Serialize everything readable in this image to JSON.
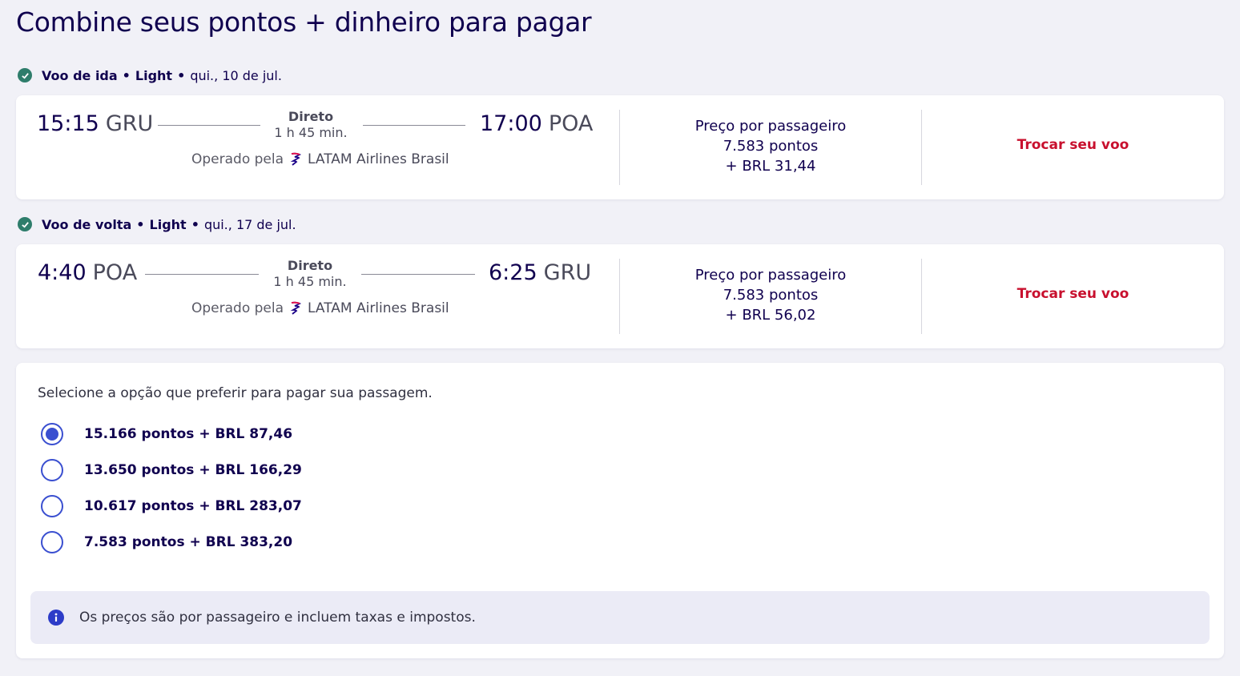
{
  "page": {
    "title": "Combine seus pontos + dinheiro para pagar"
  },
  "outbound": {
    "header": {
      "leg": "Voo de ida",
      "fare": "Light",
      "date": "qui., 10 de jul."
    },
    "dep_time": "15:15",
    "dep_code": "GRU",
    "arr_time": "17:00",
    "arr_code": "POA",
    "stops": "Direto",
    "duration": "1 h 45 min.",
    "operated_prefix": "Operado pela",
    "airline": "LATAM Airlines Brasil",
    "price_label": "Preço por passageiro",
    "price_points": "7.583 pontos",
    "price_cash": "+ BRL 31,44",
    "change_label": "Trocar seu voo"
  },
  "return": {
    "header": {
      "leg": "Voo de volta",
      "fare": "Light",
      "date": "qui., 17 de jul."
    },
    "dep_time": "4:40",
    "dep_code": "POA",
    "arr_time": "6:25",
    "arr_code": "GRU",
    "stops": "Direto",
    "duration": "1 h 45 min.",
    "operated_prefix": "Operado pela",
    "airline": "LATAM Airlines Brasil",
    "price_label": "Preço por passageiro",
    "price_points": "7.583 pontos",
    "price_cash": "+ BRL 56,02",
    "change_label": "Trocar seu voo"
  },
  "payment": {
    "intro": "Selecione a opção que preferir para pagar sua passagem.",
    "options": [
      {
        "label": "15.166 pontos + BRL 87,46",
        "selected": true
      },
      {
        "label": "13.650 pontos + BRL 166,29",
        "selected": false
      },
      {
        "label": "10.617 pontos + BRL 283,07",
        "selected": false
      },
      {
        "label": "7.583 pontos + BRL 383,20",
        "selected": false
      }
    ],
    "info": "Os preços são por passageiro e incluem taxas e impostos."
  },
  "colors": {
    "brand_navy": "#10004f",
    "accent_red": "#c8102e",
    "radio_blue": "#3a4fd0",
    "check_green": "#2e7d6b"
  }
}
